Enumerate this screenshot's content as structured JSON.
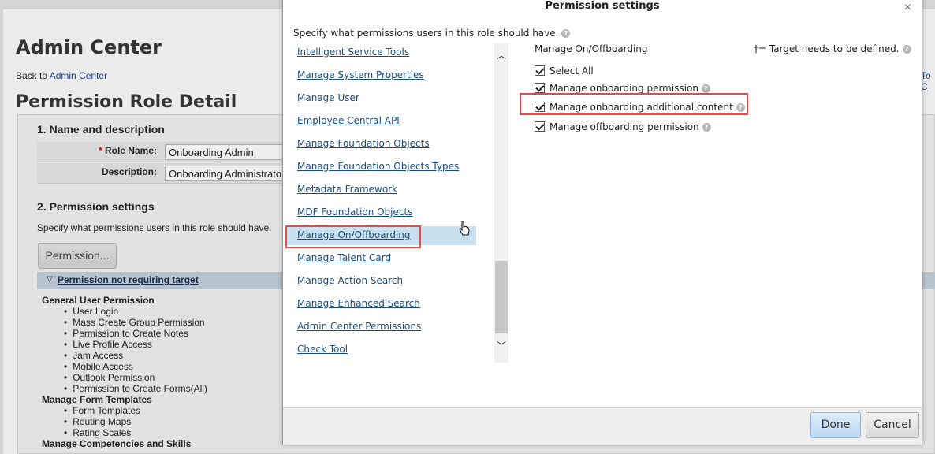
{
  "background": {
    "title": "Admin Center",
    "back_prefix": "Back to ",
    "back_link": "Admin Center",
    "right_link": "To C",
    "page_title": "Permission Role Detail",
    "section1_title": "1. Name and description",
    "role_name_label": "Role Name:",
    "role_name_value": "Onboarding Admin",
    "description_label": "Description:",
    "description_value": "Onboarding Administrato",
    "section2_title": "2. Permission settings",
    "section2_desc": "Specify what permissions users in this role should have.",
    "permission_button": "Permission...",
    "bar_label": "Permission not requiring target",
    "groups": [
      {
        "name": "General User Permission",
        "items": [
          "User Login",
          "Mass Create Group Permission",
          "Permission to Create Notes",
          "Live Profile Access",
          "Jam Access",
          "Mobile Access",
          "Outlook Permission",
          "Permission to Create Forms(All)"
        ]
      },
      {
        "name": "Manage Form Templates",
        "items": [
          "Form Templates",
          "Routing Maps",
          "Rating Scales"
        ]
      },
      {
        "name": "Manage Competencies and Skills",
        "items": []
      }
    ]
  },
  "modal": {
    "title": "Permission settings",
    "close": "×",
    "instructions": "Specify what permissions users in this role should have.",
    "categories": [
      "Intelligent Service Tools",
      "Manage System Properties",
      "Manage User",
      "Employee Central API",
      "Manage Foundation Objects",
      "Manage Foundation Objects Types",
      "Metadata Framework",
      "MDF Foundation Objects",
      "Manage On/Offboarding",
      "Manage Talent Card",
      "Manage Action Search",
      "Manage Enhanced Search",
      "Admin Center Permissions",
      "Check Tool"
    ],
    "selected_category": "Manage On/Offboarding",
    "permission_heading": "Manage On/Offboarding",
    "target_note": "†= Target needs to be defined.",
    "select_all": "Select All",
    "permissions": [
      {
        "label": "Manage onboarding permission",
        "checked": true
      },
      {
        "label": "Manage onboarding additional content",
        "checked": true
      },
      {
        "label": "Manage offboarding permission",
        "checked": true
      }
    ],
    "done": "Done",
    "cancel": "Cancel",
    "help_glyph": "?"
  },
  "colors": {
    "link": "#1b4e7c",
    "highlight_box": "#e14b4b",
    "selected_row": "#c9e1ee"
  }
}
